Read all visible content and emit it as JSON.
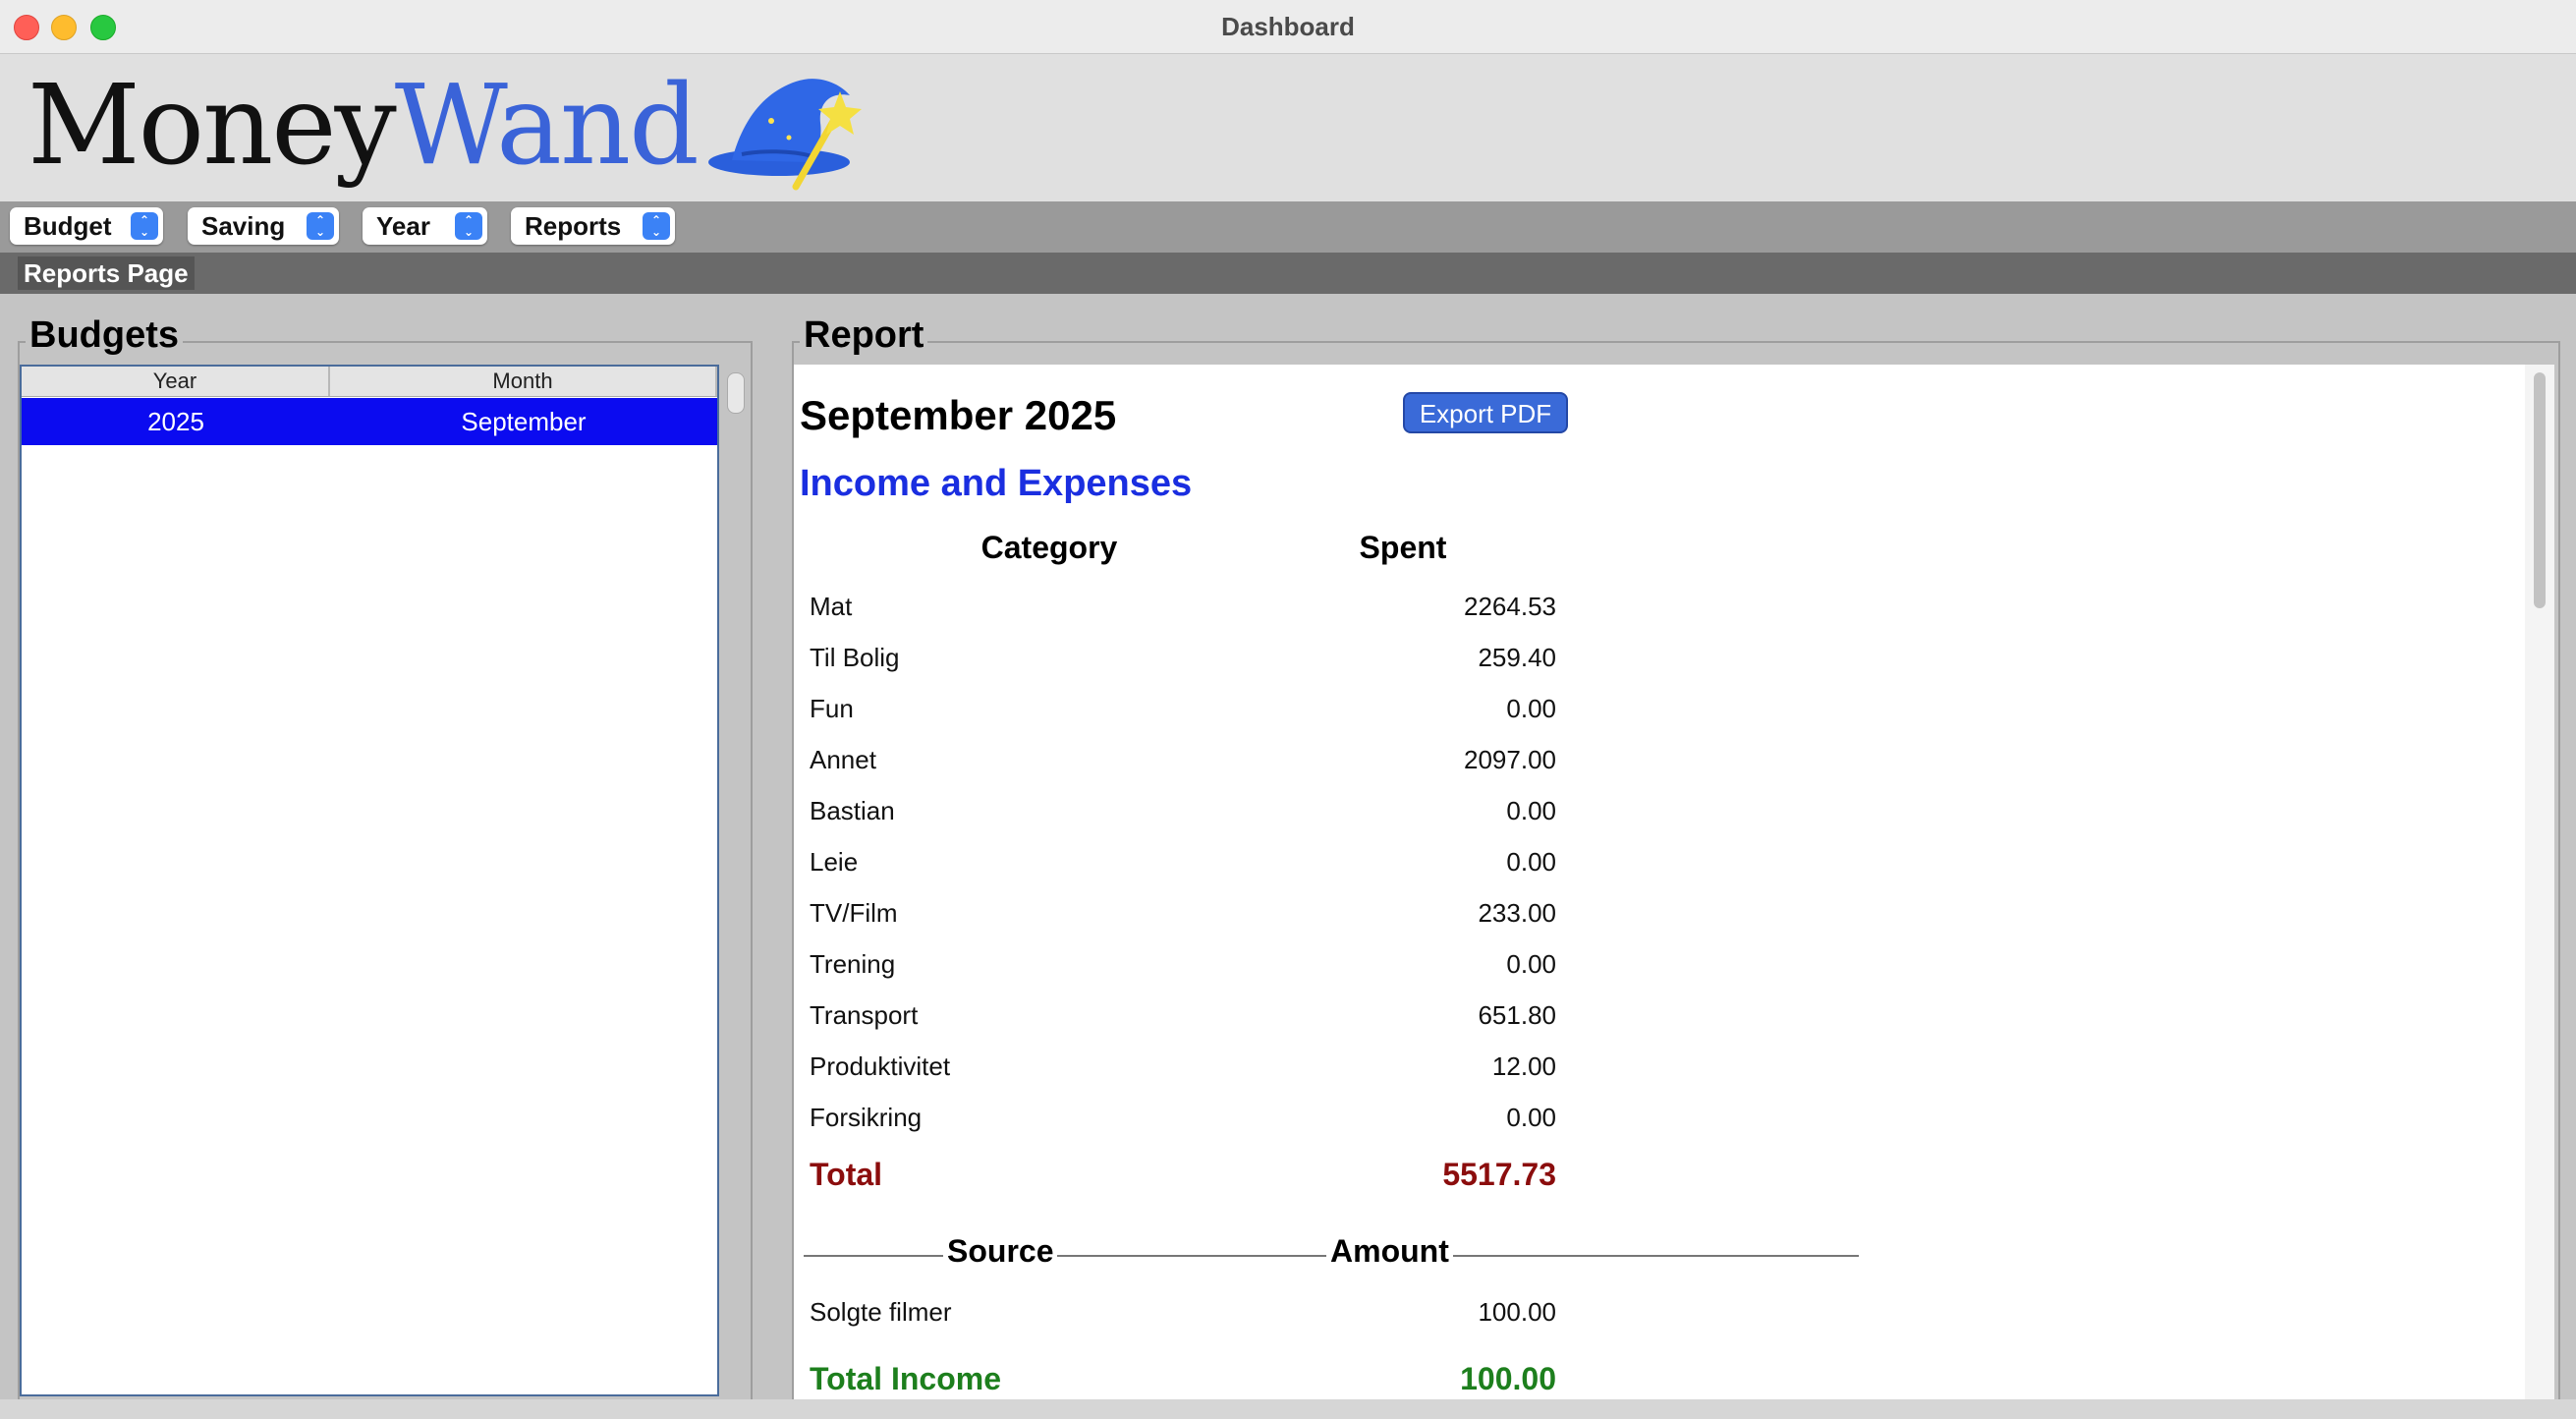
{
  "window": {
    "title": "Dashboard"
  },
  "logo": {
    "part1": "Money",
    "part2": "Wand",
    "icon": "wizard-hat-wand-icon"
  },
  "toolbar": {
    "dropdowns": [
      {
        "label": "Budget"
      },
      {
        "label": "Saving"
      },
      {
        "label": "Year"
      },
      {
        "label": "Reports"
      }
    ]
  },
  "page": {
    "label": "Reports Page"
  },
  "budgets": {
    "title": "Budgets",
    "columns": [
      "Year",
      "Month"
    ],
    "rows": [
      {
        "year": "2025",
        "month": "September",
        "selected": true
      }
    ]
  },
  "report": {
    "title": "Report",
    "heading": "September 2025",
    "export_label": "Export PDF",
    "section_title": "Income and Expenses",
    "expense_headers": {
      "category": "Category",
      "spent": "Spent"
    },
    "expenses": [
      {
        "category": "Mat",
        "spent": "2264.53"
      },
      {
        "category": "Til Bolig",
        "spent": "259.40"
      },
      {
        "category": "Fun",
        "spent": "0.00"
      },
      {
        "category": "Annet",
        "spent": "2097.00"
      },
      {
        "category": "Bastian",
        "spent": "0.00"
      },
      {
        "category": "Leie",
        "spent": "0.00"
      },
      {
        "category": "TV/Film",
        "spent": "233.00"
      },
      {
        "category": "Trening",
        "spent": "0.00"
      },
      {
        "category": "Transport",
        "spent": "651.80"
      },
      {
        "category": "Produktivitet",
        "spent": "12.00"
      },
      {
        "category": "Forsikring",
        "spent": "0.00"
      }
    ],
    "total_label": "Total",
    "total_value": "5517.73",
    "income_headers": {
      "source": "Source",
      "amount": "Amount"
    },
    "income": [
      {
        "source": "Solgte filmer",
        "amount": "100.00"
      }
    ],
    "income_total_label": "Total Income",
    "income_total_value": "100.00"
  },
  "colors": {
    "accent_blue": "#3a63d8",
    "selection": "#0b0bf0",
    "section_title": "#1a2ee0",
    "total_red": "#8b0d0d",
    "income_green": "#1d7f1d"
  }
}
